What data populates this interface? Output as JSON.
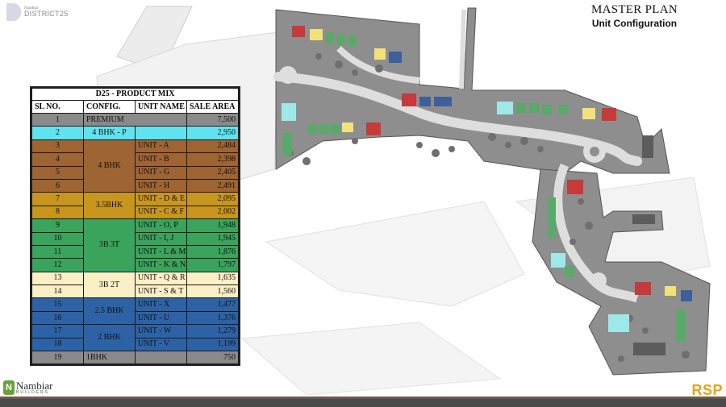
{
  "brand_top": {
    "small": "Nambiar",
    "big": "DISTRICT25"
  },
  "header": {
    "title": "MASTER PLAN",
    "subtitle": "Unit Configuration"
  },
  "product_mix": {
    "caption": "D25 - PRODUCT MIX",
    "columns": [
      "SL NO.",
      "CONFIG.",
      "UNIT NAME",
      "SALE AREA"
    ],
    "rows": [
      {
        "sl": "1",
        "config": "PREMIUM",
        "unit": "",
        "area": "7,500",
        "color": "#8a8a8a"
      },
      {
        "sl": "2",
        "config": "4 BHK - P",
        "unit": "",
        "area": "2,950",
        "color": "#5fe4ef"
      },
      {
        "sl": "3",
        "config": "4 BHK",
        "unit": "UNIT - A",
        "area": "2,484",
        "color": "#9e6432"
      },
      {
        "sl": "4",
        "config": "4 BHK",
        "unit": "UNIT - B",
        "area": "2,398",
        "color": "#9e6432"
      },
      {
        "sl": "5",
        "config": "4 BHK",
        "unit": "UNIT - G",
        "area": "2,405",
        "color": "#9e6432"
      },
      {
        "sl": "6",
        "config": "4 BHK",
        "unit": "UNIT - H",
        "area": "2,491",
        "color": "#9e6432"
      },
      {
        "sl": "7",
        "config": "3.5BHK",
        "unit": "UNIT - D & E",
        "area": "2,095",
        "color": "#c8961c"
      },
      {
        "sl": "8",
        "config": "3.5BHK",
        "unit": "UNIT - C & F",
        "area": "2,002",
        "color": "#c8961c"
      },
      {
        "sl": "9",
        "config": "3B 3T",
        "unit": "UNIT - O, P",
        "area": "1,948",
        "color": "#3aa35c"
      },
      {
        "sl": "10",
        "config": "3B 3T",
        "unit": "UNIT - I, J",
        "area": "1,945",
        "color": "#3aa35c"
      },
      {
        "sl": "11",
        "config": "3B 3T",
        "unit": "UNIT - L & M",
        "area": "1,876",
        "color": "#3aa35c"
      },
      {
        "sl": "12",
        "config": "3B 3T",
        "unit": "UNIT - K & N",
        "area": "1,797",
        "color": "#3aa35c"
      },
      {
        "sl": "13",
        "config": "3B 2T",
        "unit": "UNIT - Q & R",
        "area": "1,635",
        "color": "#fbefc6"
      },
      {
        "sl": "14",
        "config": "3B 2T",
        "unit": "UNIT - S & T",
        "area": "1,560",
        "color": "#fbefc6"
      },
      {
        "sl": "15",
        "config": "2.5 BHK",
        "unit": "UNIT - X",
        "area": "1,477",
        "color": "#2d63a6"
      },
      {
        "sl": "16",
        "config": "2.5 BHK",
        "unit": "UNIT - U",
        "area": "1,376",
        "color": "#2d63a6"
      },
      {
        "sl": "17",
        "config": "2 BHK",
        "unit": "UNIT - W",
        "area": "1,279",
        "color": "#2d63a6"
      },
      {
        "sl": "18",
        "config": "2 BHK",
        "unit": "UNIT - V",
        "area": "1,199",
        "color": "#2d63a6"
      },
      {
        "sl": "19",
        "config": "1BHK",
        "unit": "",
        "area": "750",
        "color": "#8a8a8a"
      }
    ]
  },
  "footer": {
    "left_brand": "Nambiar",
    "left_sub": "BUILDERS",
    "right_brand": "RSP"
  },
  "map_colors": {
    "site": "#8c8c8c",
    "road": "#d9d9d9",
    "tree": "#6f6f6f",
    "red": "#c63a3a",
    "yellow": "#f1e27a",
    "cyan": "#9fe8ea",
    "green": "#5aa86a",
    "blue": "#3d5f9a"
  }
}
